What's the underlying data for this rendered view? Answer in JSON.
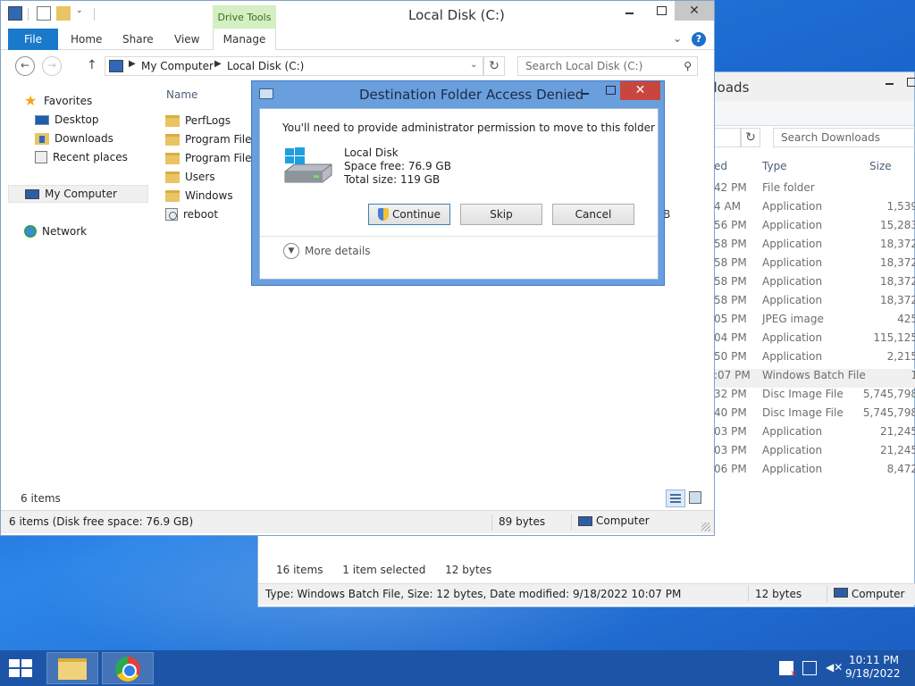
{
  "back_window": {
    "title": "nloads",
    "search_placeholder": "Search Downloads",
    "columns": [
      "ed",
      "Type",
      "Size"
    ],
    "rows": [
      {
        "date": "42 PM",
        "type": "File folder",
        "size": ""
      },
      {
        "date": "4 AM",
        "type": "Application",
        "size": "1,539"
      },
      {
        "date": "56 PM",
        "type": "Application",
        "size": "15,283"
      },
      {
        "date": "58 PM",
        "type": "Application",
        "size": "18,372"
      },
      {
        "date": "58 PM",
        "type": "Application",
        "size": "18,372"
      },
      {
        "date": "58 PM",
        "type": "Application",
        "size": "18,372"
      },
      {
        "date": "58 PM",
        "type": "Application",
        "size": "18,372"
      },
      {
        "date": "05 PM",
        "type": "JPEG image",
        "size": "425"
      },
      {
        "date": "04 PM",
        "type": "Application",
        "size": "115,125"
      },
      {
        "date": "50 PM",
        "type": "Application",
        "size": "2,215"
      },
      {
        "date": ":07 PM",
        "type": "Windows Batch File",
        "size": "1"
      },
      {
        "date": "32 PM",
        "type": "Disc Image File",
        "size": "5,745,798"
      },
      {
        "date": "40 PM",
        "type": "Disc Image File",
        "size": "5,745,798"
      },
      {
        "date": "03 PM",
        "type": "Application",
        "size": "21,245"
      },
      {
        "date": "03 PM",
        "type": "Application",
        "size": "21,245"
      },
      {
        "date": "06 PM",
        "type": "Application",
        "size": "8,472"
      }
    ],
    "selected_row": 10,
    "status_items": "16 items",
    "status_selected": "1 item selected",
    "status_selected_size": "12 bytes",
    "details": "Type: Windows Batch File, Size: 12 bytes, Date modified: 9/18/2022 10:07 PM",
    "details_size": "12 bytes",
    "details_location": "Computer"
  },
  "front_window": {
    "title": "Local Disk (C:)",
    "context_tab": "Drive Tools",
    "tabs": [
      "File",
      "Home",
      "Share",
      "View",
      "Manage"
    ],
    "breadcrumb": [
      "My Computer",
      "Local Disk (C:)"
    ],
    "search_placeholder": "Search Local Disk (C:)",
    "nav": {
      "favorites": "Favorites",
      "desktop": "Desktop",
      "downloads": "Downloads",
      "recent": "Recent places",
      "computer": "My Computer",
      "network": "Network"
    },
    "column_name": "Name",
    "files": [
      {
        "name": "PerfLogs",
        "kind": "folder"
      },
      {
        "name": "Program Files",
        "kind": "folder"
      },
      {
        "name": "Program Files",
        "kind": "folder"
      },
      {
        "name": "Users",
        "kind": "folder"
      },
      {
        "name": "Windows",
        "kind": "folder"
      },
      {
        "name": "reboot",
        "kind": "batch"
      }
    ],
    "partial_size_fragment": "B",
    "items_count": "6 items",
    "status_left": "6 items (Disk free space: 76.9 GB)",
    "status_size": "89 bytes",
    "status_location": "Computer"
  },
  "dialog": {
    "title": "Destination Folder Access Denied",
    "message": "You'll need to provide administrator permission to move to this folder",
    "drive_name": "Local Disk",
    "space_free": "Space free: 76.9 GB",
    "total_size": "Total size: 119 GB",
    "continue_label": "Continue",
    "skip_label": "Skip",
    "cancel_label": "Cancel",
    "more_details": "More details"
  },
  "taskbar": {
    "time": "10:11 PM",
    "date": "9/18/2022"
  },
  "icons": {
    "close": "✕",
    "refresh": "↻",
    "search": "⚲",
    "up": "↑",
    "back": "←",
    "forward": "→",
    "chevron_down": "⌄",
    "help": "?"
  }
}
